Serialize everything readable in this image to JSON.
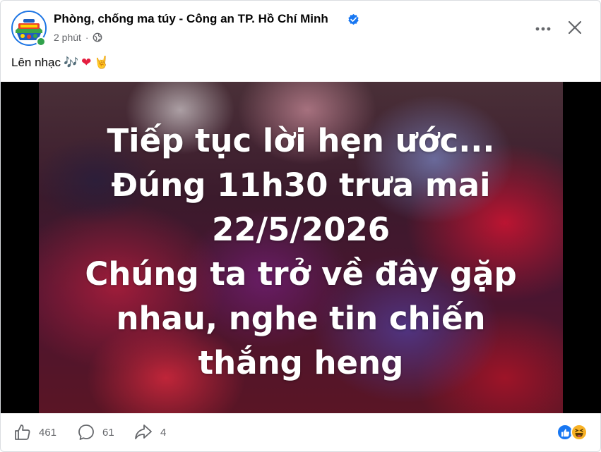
{
  "header": {
    "page_name": "Phòng, chống ma túy - Công an TP. Hồ Chí Minh",
    "timestamp": "2 phút",
    "separator": "·",
    "avatar_icon": "police-emblem-avatar-icon",
    "verified_icon": "verified-badge-icon",
    "privacy_icon": "globe-icon",
    "more_icon": "more-dots-icon",
    "close_icon": "close-icon"
  },
  "caption": {
    "text": "Lên nhạc",
    "emojis": [
      "🎶",
      "❤",
      "🤘"
    ]
  },
  "media": {
    "lines": [
      "Tiếp tục lời hẹn ước...",
      "Đúng 11h30 trưa mai",
      "22/5/2026",
      "Chúng ta trở về đây gặp",
      "nhau, nghe tin chiến",
      "thắng heng"
    ]
  },
  "footer": {
    "likes": "461",
    "comments": "61",
    "shares": "4",
    "like_icon": "thumbs-up-icon",
    "comment_icon": "comment-bubble-icon",
    "share_icon": "share-arrow-icon",
    "reaction_icons": [
      "like-reaction-icon",
      "haha-reaction-icon"
    ]
  },
  "colors": {
    "brand_blue": "#1877f2",
    "online_green": "#31a24c",
    "secondary_text": "#65676b"
  }
}
